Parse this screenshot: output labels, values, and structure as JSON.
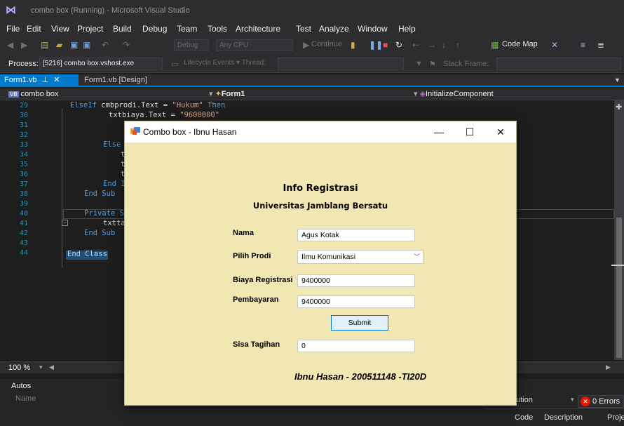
{
  "vs": {
    "window_title": "combo box (Running) - Microsoft Visual Studio",
    "menu": [
      "File",
      "Edit",
      "View",
      "Project",
      "Build",
      "Debug",
      "Team",
      "Tools",
      "Architecture",
      "Test",
      "Analyze",
      "Window",
      "Help"
    ],
    "toolbar": {
      "config": "Debug",
      "platform": "Any CPU",
      "continue_label": "Continue",
      "code_map_label": "Code Map"
    },
    "debug": {
      "process_label": "Process:",
      "process_value": "[5216] combo box.vshost.exe",
      "lifecycle_label": "Lifecycle Events",
      "thread_label": "Thread:",
      "stack_label": "Stack Frame:"
    },
    "tabs": [
      {
        "label": "Form1.vb",
        "active": true
      },
      {
        "label": "Form1.vb [Design]",
        "active": false
      }
    ],
    "nav": {
      "project": "combo box",
      "class": "Form1",
      "member": "InitializeComponent"
    },
    "code_lines": [
      {
        "n": "29",
        "text": "            ElseIf cmbprodi.Text = \"Hukum\" Then"
      },
      {
        "n": "30",
        "text": "                txtbiaya.Text = \"9600000\""
      },
      {
        "n": "31",
        "text": "                t"
      },
      {
        "n": "32",
        "text": "                t"
      },
      {
        "n": "33",
        "text": "            Else"
      },
      {
        "n": "34",
        "text": "                t"
      },
      {
        "n": "35",
        "text": "                t"
      },
      {
        "n": "36",
        "text": "                t"
      },
      {
        "n": "37",
        "text": "            End I"
      },
      {
        "n": "38",
        "text": "        End Sub"
      },
      {
        "n": "39",
        "text": ""
      },
      {
        "n": "40",
        "text": "        Private S"
      },
      {
        "n": "41",
        "text": "            txtta"
      },
      {
        "n": "42",
        "text": "        End Sub"
      },
      {
        "n": "43",
        "text": "End Class"
      },
      {
        "n": "44",
        "text": ""
      }
    ],
    "zoom": "100 %",
    "autos_title": "Autos",
    "autos_name_col": "Name",
    "error_list": {
      "errors": "0 Errors",
      "code_col": "Code",
      "desc_col": "Description",
      "proj_col": "Proje",
      "solution_partial": "ution"
    }
  },
  "dialog": {
    "title": "Combo box - Ibnu Hasan",
    "heading": "Info Registrasi",
    "subheading": "Universitas Jamblang Bersatu",
    "fields": {
      "nama_label": "Nama",
      "nama_value": "Agus Kotak",
      "prodi_label": "Pilih Prodi",
      "prodi_value": "Ilmu Komunikasi",
      "biaya_label": "Biaya Registrasi",
      "biaya_value": "9400000",
      "bayar_label": "Pembayaran",
      "bayar_value": "9400000",
      "sisa_label": "Sisa Tagihan",
      "sisa_value": "0"
    },
    "submit_label": "Submit",
    "footer": "Ibnu Hasan - 200511148 -TI20D",
    "min_glyph": "—",
    "max_glyph": "☐",
    "close_glyph": "✕"
  }
}
